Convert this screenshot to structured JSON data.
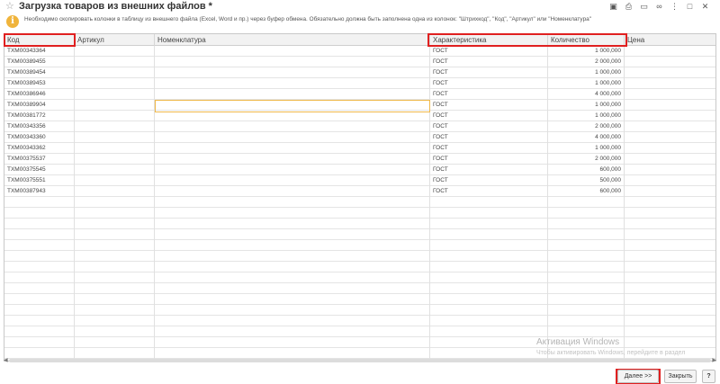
{
  "window": {
    "title": "Загрузка товаров из внешних файлов *",
    "star_icon": "star-icon",
    "icons": [
      "save-icon",
      "print-icon",
      "tray-icon",
      "link-icon",
      "more-icon",
      "maximize-icon",
      "close-icon"
    ]
  },
  "info": {
    "icon": "info-icon",
    "text": "Необходимо скопировать колонки в таблицу из внешнего файла (Excel, Word и пр.) через буфер обмена. Обязательно должна быть заполнена одна из колонок: \"Штрихкод\", \"Код\", \"Артикул\" или \"Номенклатура\""
  },
  "table": {
    "columns": [
      "Код",
      "Артикул",
      "Номенклатура",
      "Характеристика",
      "Количество",
      "Цена"
    ],
    "rows": [
      {
        "code": "ТХМ00343364",
        "article": "",
        "nomenclature": "",
        "characteristic": "ГОСТ",
        "quantity": "1 000,000",
        "price": ""
      },
      {
        "code": "ТХМ00389455",
        "article": "",
        "nomenclature": "",
        "characteristic": "ГОСТ",
        "quantity": "2 000,000",
        "price": ""
      },
      {
        "code": "ТХМ00389454",
        "article": "",
        "nomenclature": "",
        "characteristic": "ГОСТ",
        "quantity": "1 000,000",
        "price": ""
      },
      {
        "code": "ТХМ00389453",
        "article": "",
        "nomenclature": "",
        "characteristic": "ГОСТ",
        "quantity": "1 000,000",
        "price": ""
      },
      {
        "code": "ТХМ00386946",
        "article": "",
        "nomenclature": "",
        "characteristic": "ГОСТ",
        "quantity": "4 000,000",
        "price": ""
      },
      {
        "code": "ТХМ00389904",
        "article": "",
        "nomenclature": "",
        "characteristic": "ГОСТ",
        "quantity": "1 000,000",
        "price": ""
      },
      {
        "code": "ТХМ00381772",
        "article": "",
        "nomenclature": "",
        "characteristic": "ГОСТ",
        "quantity": "1 000,000",
        "price": ""
      },
      {
        "code": "ТХМ00343356",
        "article": "",
        "nomenclature": "",
        "characteristic": "ГОСТ",
        "quantity": "2 000,000",
        "price": ""
      },
      {
        "code": "ТХМ00343360",
        "article": "",
        "nomenclature": "",
        "characteristic": "ГОСТ",
        "quantity": "4 000,000",
        "price": ""
      },
      {
        "code": "ТХМ00343362",
        "article": "",
        "nomenclature": "",
        "characteristic": "ГОСТ",
        "quantity": "1 000,000",
        "price": ""
      },
      {
        "code": "ТХМ00375537",
        "article": "",
        "nomenclature": "",
        "characteristic": "ГОСТ",
        "quantity": "2 000,000",
        "price": ""
      },
      {
        "code": "ТХМ00375545",
        "article": "",
        "nomenclature": "",
        "characteristic": "ГОСТ",
        "quantity": "600,000",
        "price": ""
      },
      {
        "code": "ТХМ00375551",
        "article": "",
        "nomenclature": "",
        "characteristic": "ГОСТ",
        "quantity": "500,000",
        "price": ""
      },
      {
        "code": "ТХМ00387943",
        "article": "",
        "nomenclature": "",
        "characteristic": "ГОСТ",
        "quantity": "600,000",
        "price": ""
      }
    ]
  },
  "watermark": {
    "line1": "Активация Windows",
    "line2": "Чтобы активировать Windows, перейдите в раздел"
  },
  "buttons": {
    "next": "Далее >>",
    "close": "Закрыть",
    "help": "?"
  },
  "colors": {
    "highlight": "#e02020",
    "focus": "#efb84a",
    "info": "#f0b43c"
  }
}
